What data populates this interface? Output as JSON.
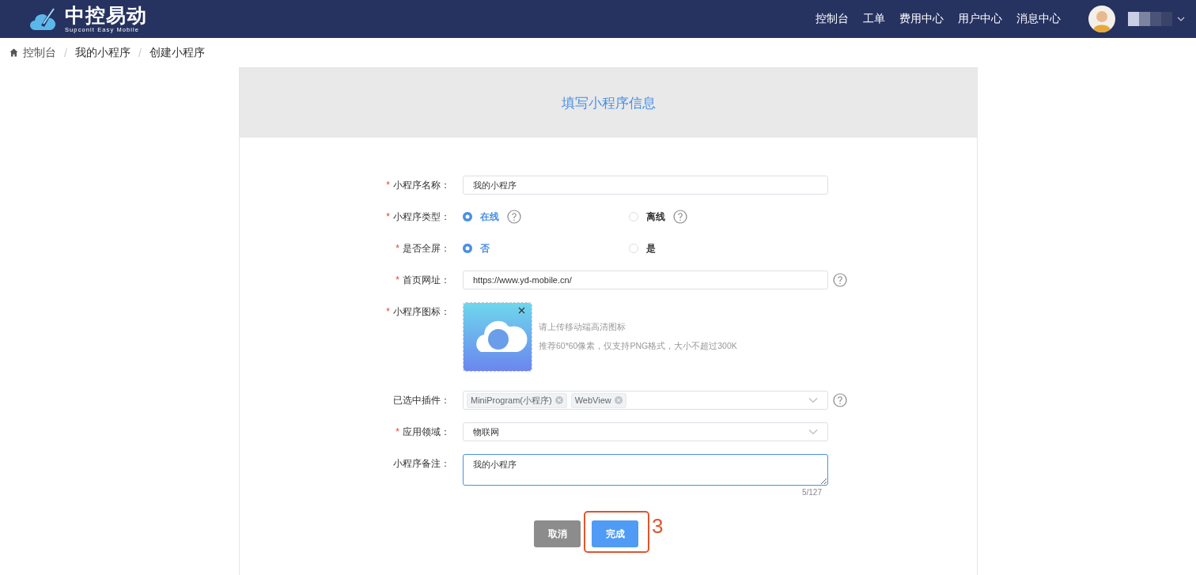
{
  "header": {
    "logo_title": "中控易动",
    "logo_subtitle": "Supconit Easy Mobile",
    "nav": [
      {
        "label": "控制台"
      },
      {
        "label": "工单"
      },
      {
        "label": "费用中心"
      },
      {
        "label": "用户中心"
      },
      {
        "label": "消息中心"
      }
    ]
  },
  "breadcrumb": [
    {
      "label": "控制台"
    },
    {
      "separator": "/",
      "label": "我的小程序"
    },
    {
      "separator": "/",
      "label": "创建小程序"
    }
  ],
  "card": {
    "title": "填写小程序信息",
    "fields": [
      {
        "kind": "text",
        "required_mark": "*",
        "label": "小程序名称：",
        "value": "我的小程序",
        "help": false
      },
      {
        "kind": "radio",
        "required_mark": "*",
        "label": "小程序类型：",
        "options": [
          {
            "label": "在线",
            "selected": true,
            "help": true
          },
          {
            "label": "离线",
            "selected": false,
            "help": true
          }
        ]
      },
      {
        "kind": "radio",
        "required_mark": "*",
        "label": "是否全屏：",
        "options": [
          {
            "label": "否",
            "selected": true,
            "help": false
          },
          {
            "label": "是",
            "selected": false,
            "help": false
          }
        ]
      },
      {
        "kind": "text",
        "required_mark": "*",
        "label": "首页网址：",
        "value": "https://www.yd-mobile.cn/",
        "help": true
      },
      {
        "kind": "upload",
        "required_mark": "*",
        "label": "小程序图标：",
        "hints": [
          "请上传移动端高清图标",
          "推荐60*60像素，仅支持PNG格式，大小不超过300K"
        ]
      },
      {
        "kind": "tags",
        "label": "已选中插件：",
        "tags": [
          "MiniProgram(小程序)",
          "WebView"
        ],
        "help": true
      },
      {
        "kind": "select",
        "required_mark": "*",
        "label": "应用领域：",
        "value": "物联网",
        "help": false
      },
      {
        "kind": "textarea",
        "label": "小程序备注：",
        "value": "我的小程序",
        "counter": "5/127",
        "focused": true
      }
    ],
    "buttons": [
      {
        "label": "取消",
        "kind": "secondary",
        "highlighted": false
      },
      {
        "label": "完成",
        "kind": "primary",
        "highlighted": true
      }
    ],
    "annotation": "3"
  }
}
